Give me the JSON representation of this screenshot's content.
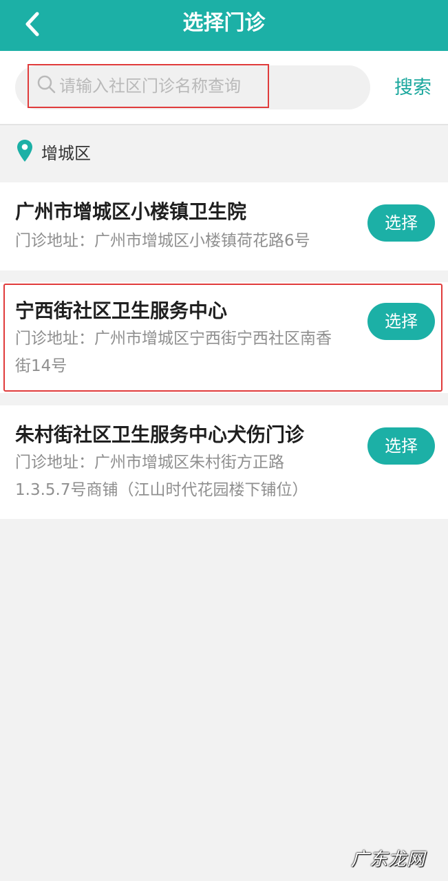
{
  "header": {
    "title": "选择门诊",
    "background_color": "#1cb0a6"
  },
  "search": {
    "placeholder": "请输入社区门诊名称查询",
    "value": "",
    "button_label": "搜索"
  },
  "district": {
    "label": "增城区"
  },
  "clinics": [
    {
      "name": "广州市增城区小楼镇卫生院",
      "address": "门诊地址：广州市增城区小楼镇荷花路6号",
      "button_label": "选择"
    },
    {
      "name": "宁西街社区卫生服务中心",
      "address": "门诊地址：广州市增城区宁西街宁西社区南香街14号",
      "button_label": "选择"
    },
    {
      "name": "朱村街社区卫生服务中心犬伤门诊",
      "address": "门诊地址：广州市增城区朱村街方正路1.3.5.7号商铺（江山时代花园楼下铺位）",
      "button_label": "选择"
    }
  ],
  "watermark": "广东龙网",
  "colors": {
    "accent": "#1cb0a6",
    "highlight_border": "#e03a3a"
  }
}
